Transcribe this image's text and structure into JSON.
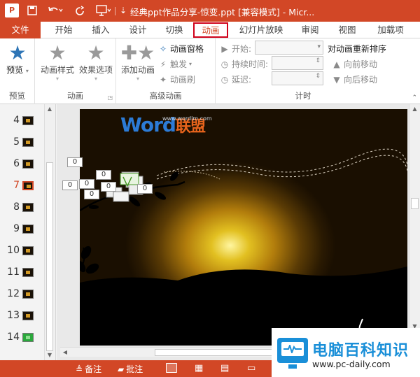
{
  "window": {
    "title": "经典ppt作品分享-惊变.ppt [兼容模式] - Micr...",
    "quick_access": [
      "save-icon",
      "undo-icon",
      "redo-icon",
      "present-icon",
      "customize-icon"
    ]
  },
  "tabs": {
    "file": "文件",
    "items": [
      "开始",
      "插入",
      "设计",
      "切换",
      "动画",
      "幻灯片放映",
      "审阅",
      "视图",
      "加载项"
    ],
    "active": "动画"
  },
  "ribbon": {
    "preview": {
      "button": "预览",
      "group": "预览"
    },
    "animation": {
      "style_button": "动画样式",
      "effect_button": "效果选项",
      "group": "动画"
    },
    "advanced": {
      "add_button": "添加动画",
      "pane": "动画窗格",
      "trigger": "触发",
      "painter": "动画刷",
      "group": "高级动画"
    },
    "timing": {
      "start_label": "开始:",
      "duration_label": "持续时间:",
      "delay_label": "延迟:",
      "reorder_title": "对动画重新排序",
      "move_earlier": "向前移动",
      "move_later": "向后移动",
      "group": "计时"
    }
  },
  "slides": {
    "numbers": [
      "4",
      "5",
      "6",
      "7",
      "8",
      "9",
      "10",
      "11",
      "12",
      "13",
      "14"
    ],
    "selected": "7"
  },
  "slide": {
    "logo_text": "Word",
    "logo_cn": "联盟",
    "logo_url": "www.wordlm.com",
    "animation_tags": [
      "0",
      "0",
      "0",
      "0",
      "0",
      "0",
      "0"
    ]
  },
  "status": {
    "notes": "备注",
    "comments": "批注"
  },
  "watermark": {
    "title": "电脑百科知识",
    "url": "www.pc-daily.com"
  },
  "colors": {
    "accent": "#d24726",
    "highlight_box": "#d0021b",
    "watermark_blue": "#1a8fd8"
  }
}
